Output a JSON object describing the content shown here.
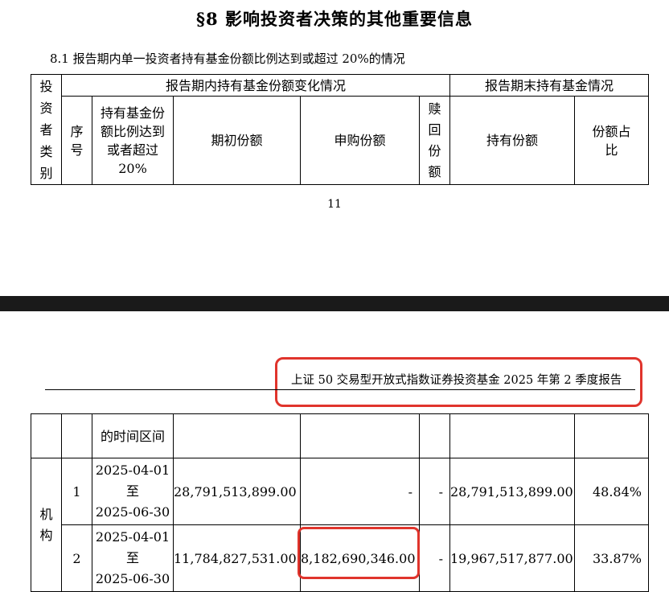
{
  "section": {
    "title": "§8  影响投资者决策的其他重要信息",
    "subtitle": "8.1  报告期内单一投资者持有基金份额比例达到或超过 20%的情况"
  },
  "table_header": {
    "investor_type": "投资者类别",
    "changes_group": "报告期内持有基金份额变化情况",
    "end_group": "报告期末持有基金情况",
    "seq": "序号",
    "period": "持有基金份额比例达到或者超过 20%",
    "period_cont": "的时间区间",
    "initial": "期初份额",
    "subscribe": "申购份额",
    "redeem": "赎回份额",
    "holding": "持有份额",
    "ratio": "份额占比"
  },
  "page_number": "11",
  "running_header": "上证 50 交易型开放式指数证券投资基金 2025 年第 2 季度报告",
  "rows": [
    {
      "type": "机构",
      "seq": "1",
      "date_from": "2025-04-01",
      "date_to_word": "至",
      "date_to": "2025-06-30",
      "initial": "28,791,513,899.00",
      "subscribe": "-",
      "redeem": "-",
      "holding": "28,791,513,899.00",
      "ratio": "48.84%"
    },
    {
      "seq": "2",
      "date_from": "2025-04-01",
      "date_to_word": "至",
      "date_to": "2025-06-30",
      "initial": "11,784,827,531.00",
      "subscribe": "8,182,690,346.00",
      "redeem": "-",
      "holding": "19,967,517,877.00",
      "ratio": "33.87%"
    }
  ],
  "colors": {
    "highlight": "#e0342c",
    "divider": "#1a1a1a"
  }
}
